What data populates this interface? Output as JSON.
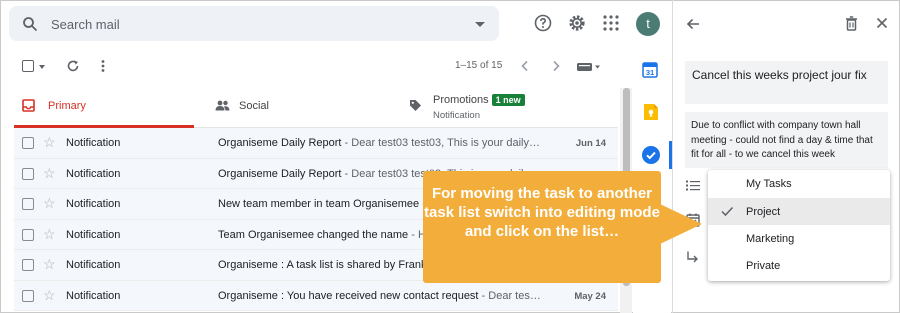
{
  "search": {
    "placeholder": "Search mail"
  },
  "header": {
    "avatar_letter": "t"
  },
  "toolbar": {
    "pager": "1–15 of 15"
  },
  "tabs": [
    {
      "label": "Primary"
    },
    {
      "label": "Social"
    },
    {
      "label": "Promotions",
      "badge": "1 new",
      "sub": "Notification"
    }
  ],
  "emails": [
    {
      "sender": "Notification",
      "subject": "Organiseme Daily Report",
      "snippet": " - Dear test03 test03, This is your daily…",
      "date": "Jun 14"
    },
    {
      "sender": "Notification",
      "subject": "Organiseme Daily Report",
      "snippet": " - Dear test03 test03, This is your daily…",
      "date": ""
    },
    {
      "sender": "Notification",
      "subject": "New team member in team Organisemee",
      "snippet": " - …",
      "date": ""
    },
    {
      "sender": "Notification",
      "subject": "Team Organisemee changed the name",
      "snippet": " - H…",
      "date": ""
    },
    {
      "sender": "Notification",
      "subject": "Organiseme : A task list is shared by Frank",
      "snippet": "",
      "date": ""
    },
    {
      "sender": "Notification",
      "subject": "Organiseme : You have received new contact request",
      "snippet": " - Dear tes…",
      "date": "May 24"
    }
  ],
  "task": {
    "title": "Cancel this weeks project jour fix",
    "description": "Due to conflict with company town hall meeting - could not find a day & time that fit for all - to we cancel this week"
  },
  "task_lists": {
    "items": [
      "My Tasks",
      "Project",
      "Marketing",
      "Private"
    ],
    "selected": "Project"
  },
  "callout": {
    "text": "For moving the task to another task list switch into editing mode and click on the list…"
  },
  "colors": {
    "accent_red": "#d93025",
    "badge_green": "#188038",
    "callout": "#f3ad3b",
    "avatar": "#4a7c73"
  }
}
